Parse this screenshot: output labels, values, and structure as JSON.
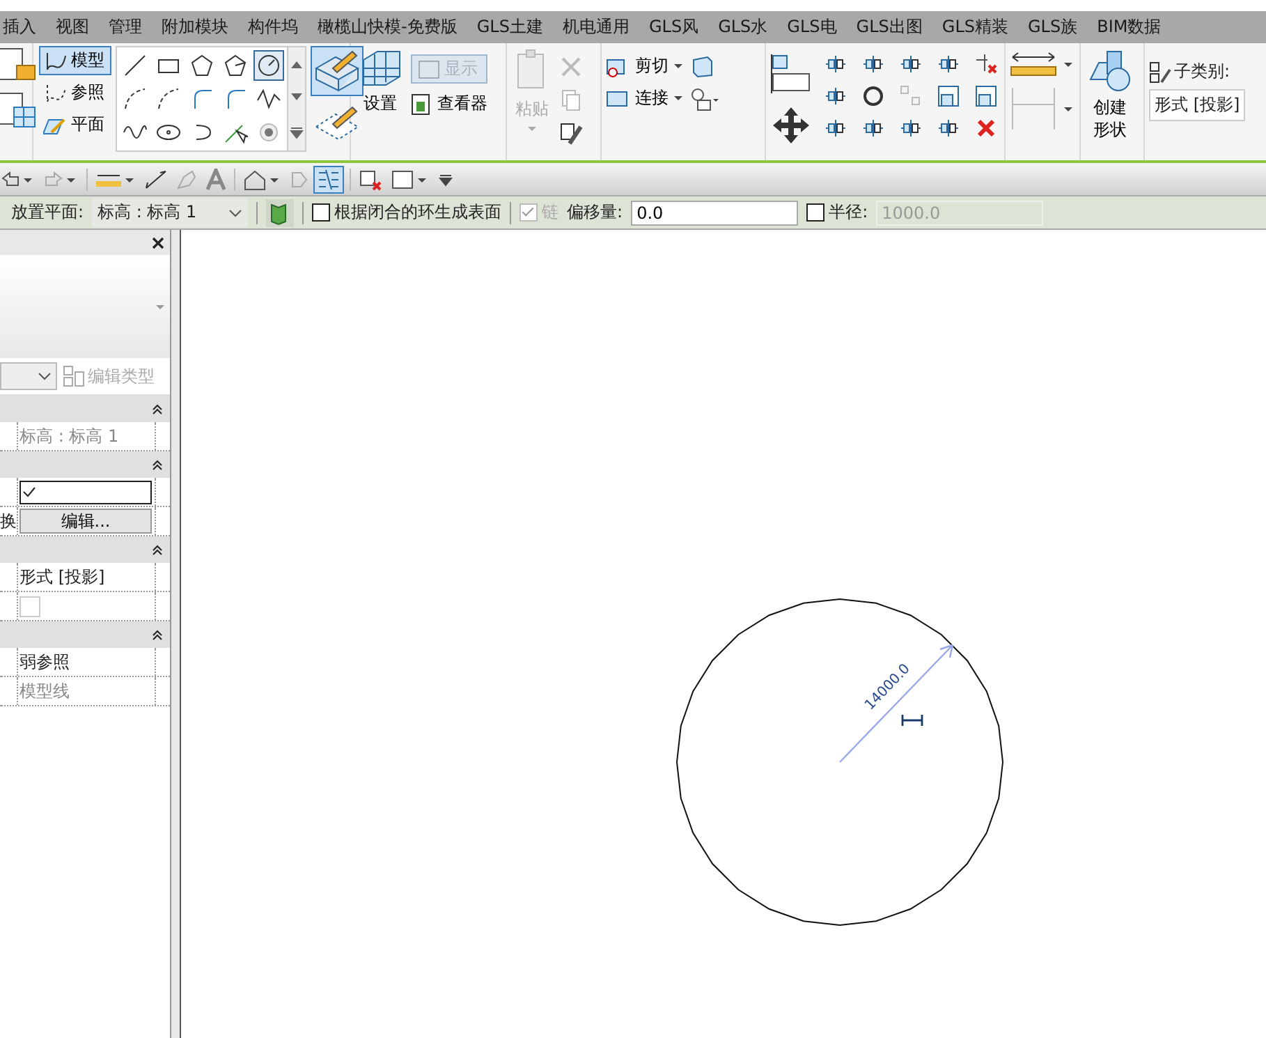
{
  "menu_tabs": [
    "插入",
    "视图",
    "管理",
    "附加模块",
    "构件坞",
    "橄榄山快模-免费版",
    "GLS土建",
    "机电通用",
    "GLS风",
    "GLS水",
    "GLS电",
    "GLS出图",
    "GLS精装",
    "GLS族",
    "BIM数据"
  ],
  "draw_panel": {
    "modes": [
      {
        "label": "模型",
        "kind": "model",
        "selected": true
      },
      {
        "label": "参照",
        "kind": "ref",
        "selected": false
      },
      {
        "label": "平面",
        "kind": "plane",
        "selected": false
      }
    ],
    "tools": [
      {
        "kind": "line",
        "selected": false
      },
      {
        "kind": "rect",
        "selected": false
      },
      {
        "kind": "polygon",
        "selected": false
      },
      {
        "kind": "polygon2",
        "selected": false
      },
      {
        "kind": "circle",
        "selected": true
      },
      {
        "kind": "arc",
        "selected": false
      },
      {
        "kind": "arc",
        "selected": false
      },
      {
        "kind": "arc2",
        "selected": false
      },
      {
        "kind": "arc2",
        "selected": false
      },
      {
        "kind": "spline",
        "selected": false
      },
      {
        "kind": "wave",
        "selected": false
      },
      {
        "kind": "ellipse",
        "selected": false
      },
      {
        "kind": "partial",
        "selected": false
      },
      {
        "kind": "pick",
        "selected": false
      },
      {
        "kind": "point",
        "selected": false
      }
    ],
    "big_tools": [
      {
        "kind": "plane",
        "selected": true
      },
      {
        "kind": "pick",
        "selected": false
      }
    ]
  },
  "workplane_panel": {
    "set_label": "设置",
    "show_label": "显示",
    "viewer_label": "查看器"
  },
  "clipboard_panel": {
    "paste_label": "粘贴"
  },
  "geometry_panel": {
    "cut_label": "剪切",
    "join_label": "连接"
  },
  "form_panel": {
    "create_label": "创建形状"
  },
  "subcategory": {
    "label": "子类别:",
    "value": "形式 [投影]"
  },
  "options_bar": {
    "placement_label": "放置平面:",
    "placement_value": "标高 : 标高 1",
    "surface_label": "根据闭合的环生成表面",
    "surface_checked": false,
    "chain_label": "链",
    "chain_checked": true,
    "offset_label": "偏移量:",
    "offset_value": "0.0",
    "radius_label": "半径:",
    "radius_checked": false,
    "radius_value": "1000.0"
  },
  "properties": {
    "type_button": "编辑类型",
    "groups": [
      {
        "rows": [
          {
            "kind": "text",
            "label": "",
            "value": "标高 : 标高 1",
            "readonly": true
          }
        ]
      },
      {
        "rows": [
          {
            "kind": "checkbox",
            "label": "",
            "checked": true,
            "readonly": false
          },
          {
            "kind": "button",
            "label": "换",
            "value": "编辑..."
          }
        ]
      },
      {
        "rows": [
          {
            "kind": "text",
            "label": "",
            "value": "形式 [投影]",
            "readonly": false
          },
          {
            "kind": "checkbox",
            "label": "",
            "checked": false,
            "readonly": true
          }
        ]
      },
      {
        "rows": [
          {
            "kind": "text",
            "label": "",
            "value": "弱参照",
            "readonly": false
          },
          {
            "kind": "text",
            "label": "",
            "value": "模型线",
            "readonly": true
          }
        ]
      }
    ]
  },
  "canvas": {
    "dimension": "14000.0"
  }
}
